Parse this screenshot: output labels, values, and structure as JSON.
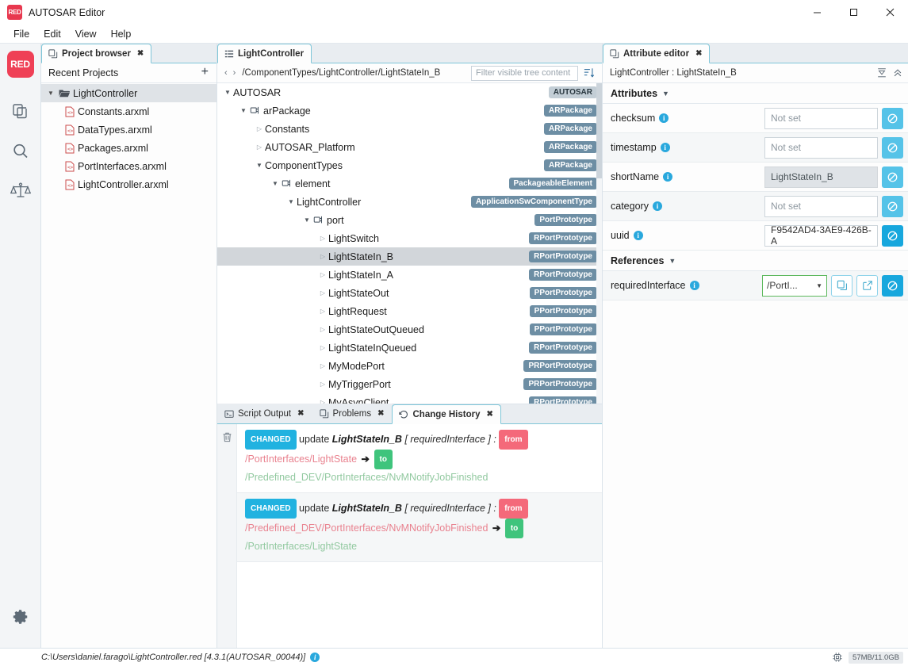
{
  "window": {
    "title": "AUTOSAR Editor",
    "logo_text": "RED",
    "controls": {
      "minimize": "minimize-button",
      "maximize": "maximize-button",
      "close": "close-button"
    }
  },
  "menubar": {
    "items": [
      "File",
      "Edit",
      "View",
      "Help"
    ]
  },
  "activitybar": {
    "logo_text": "RED",
    "items": [
      {
        "name": "project-browser-icon",
        "icon": "copy-pages-icon"
      },
      {
        "name": "search-icon",
        "icon": "magnifier-icon"
      },
      {
        "name": "compare-icon",
        "icon": "scales-icon"
      }
    ],
    "bottom": {
      "name": "settings-icon",
      "icon": "gear-icon"
    }
  },
  "project_browser": {
    "tab_label": "Project browser",
    "tab_close": "✖",
    "subheader": "Recent Projects",
    "add_label": "+",
    "root": {
      "label": "LightController",
      "expanded": true
    },
    "files": [
      "Constants.arxml",
      "DataTypes.arxml",
      "Packages.arxml",
      "PortInterfaces.arxml",
      "LightController.arxml"
    ]
  },
  "editor": {
    "tab_label": "LightController",
    "path": "/ComponentTypes/LightController/LightStateIn_B",
    "filter_placeholder": "Filter visible tree content",
    "nav_back": "‹",
    "nav_forward": "›",
    "tree": [
      {
        "label": "AUTOSAR",
        "badge": "AUTOSAR",
        "badge_style": "light",
        "indent": 0,
        "twist": "down",
        "icon": "none",
        "selected": false
      },
      {
        "label": "arPackage",
        "badge": "ARPackage",
        "badge_style": "dark",
        "indent": 1,
        "twist": "down",
        "icon": "package",
        "selected": false
      },
      {
        "label": "Constants",
        "badge": "ARPackage",
        "badge_style": "dark",
        "indent": 2,
        "twist": "right",
        "icon": "none",
        "selected": false
      },
      {
        "label": "AUTOSAR_Platform",
        "badge": "ARPackage",
        "badge_style": "dark",
        "indent": 2,
        "twist": "right",
        "icon": "none",
        "selected": false
      },
      {
        "label": "ComponentTypes",
        "badge": "ARPackage",
        "badge_style": "dark",
        "indent": 2,
        "twist": "down",
        "icon": "none",
        "selected": false
      },
      {
        "label": "element",
        "badge": "PackageableElement",
        "badge_style": "dark",
        "indent": 3,
        "twist": "down",
        "icon": "package",
        "selected": false
      },
      {
        "label": "LightController",
        "badge": "ApplicationSwComponentType",
        "badge_style": "dark",
        "indent": 4,
        "twist": "down",
        "icon": "none",
        "selected": false
      },
      {
        "label": "port",
        "badge": "PortPrototype",
        "badge_style": "dark",
        "indent": 5,
        "twist": "down",
        "icon": "package",
        "selected": false
      },
      {
        "label": "LightSwitch",
        "badge": "RPortPrototype",
        "badge_style": "dark",
        "indent": 6,
        "twist": "right",
        "icon": "none",
        "selected": false
      },
      {
        "label": "LightStateIn_B",
        "badge": "RPortPrototype",
        "badge_style": "dark",
        "indent": 6,
        "twist": "right",
        "icon": "none",
        "selected": true
      },
      {
        "label": "LightStateIn_A",
        "badge": "RPortPrototype",
        "badge_style": "dark",
        "indent": 6,
        "twist": "right",
        "icon": "none",
        "selected": false
      },
      {
        "label": "LightStateOut",
        "badge": "PPortPrototype",
        "badge_style": "dark",
        "indent": 6,
        "twist": "right",
        "icon": "none",
        "selected": false
      },
      {
        "label": "LightRequest",
        "badge": "PPortPrototype",
        "badge_style": "dark",
        "indent": 6,
        "twist": "right",
        "icon": "none",
        "selected": false
      },
      {
        "label": "LightStateOutQueued",
        "badge": "PPortPrototype",
        "badge_style": "dark",
        "indent": 6,
        "twist": "right",
        "icon": "none",
        "selected": false
      },
      {
        "label": "LightStateInQueued",
        "badge": "RPortPrototype",
        "badge_style": "dark",
        "indent": 6,
        "twist": "right",
        "icon": "none",
        "selected": false
      },
      {
        "label": "MyModePort",
        "badge": "PRPortPrototype",
        "badge_style": "dark",
        "indent": 6,
        "twist": "right",
        "icon": "none",
        "selected": false
      },
      {
        "label": "MyTriggerPort",
        "badge": "PRPortPrototype",
        "badge_style": "dark",
        "indent": 6,
        "twist": "right",
        "icon": "none",
        "selected": false
      },
      {
        "label": "MyAsynClient",
        "badge": "RPortPrototype",
        "badge_style": "dark",
        "indent": 6,
        "twist": "right",
        "icon": "none",
        "selected": false
      }
    ]
  },
  "bottom_panel": {
    "tabs": [
      {
        "label": "Script Output",
        "icon": "terminal-icon",
        "active": false
      },
      {
        "label": "Problems",
        "icon": "pages-icon",
        "active": false
      },
      {
        "label": "Change History",
        "icon": "history-icon",
        "active": true
      }
    ],
    "tab_close": "✖",
    "entries": [
      {
        "chip": "CHANGED",
        "verb": "update",
        "target": "LightStateIn_B",
        "attribute": "[ requiredInterface ] :",
        "from_chip": "from",
        "from_path": "/PortInterfaces/LightState",
        "to_chip": "to",
        "to_path": "/Predefined_DEV/PortInterfaces/NvMNotifyJobFinished"
      },
      {
        "chip": "CHANGED",
        "verb": "update",
        "target": "LightStateIn_B",
        "attribute": "[ requiredInterface ] :",
        "from_chip": "from",
        "from_path": "/Predefined_DEV/PortInterfaces/NvMNotifyJobFinished",
        "to_chip": "to",
        "to_path": "/PortInterfaces/LightState"
      }
    ]
  },
  "attribute_editor": {
    "tab_label": "Attribute editor",
    "tab_close": "✖",
    "subheader": "LightController : LightStateIn_B",
    "sections": {
      "attributes_label": "Attributes",
      "references_label": "References"
    },
    "attributes": [
      {
        "label": "checksum",
        "value": "",
        "placeholder": "Not set",
        "readonly": false,
        "shade": false,
        "btn": "clear-button"
      },
      {
        "label": "timestamp",
        "value": "",
        "placeholder": "Not set",
        "readonly": false,
        "shade": true,
        "btn": "clear-button"
      },
      {
        "label": "shortName",
        "value": "LightStateIn_B",
        "placeholder": "",
        "readonly": true,
        "shade": false,
        "btn": "clear-button"
      },
      {
        "label": "category",
        "value": "",
        "placeholder": "Not set",
        "readonly": false,
        "shade": true,
        "btn": "clear-button"
      },
      {
        "label": "uuid",
        "value": "F9542AD4-3AE9-426B-A",
        "placeholder": "",
        "readonly": false,
        "shade": false,
        "btn": "clear-button"
      }
    ],
    "references": [
      {
        "label": "requiredInterface",
        "value": "/PortI...",
        "shade": true
      }
    ]
  },
  "statusbar": {
    "path": "C:\\Users\\daniel.farago\\LightController.red [4.3.1(AUTOSAR_00044)]",
    "memory": "57MB/11.0GB"
  },
  "colors": {
    "accent_red": "#ef4056",
    "badge_dark": "#6d8ea4",
    "badge_light": "#c3ced6",
    "chip_changed": "#21b2e0",
    "chip_from": "#f4697a",
    "chip_to": "#3fc47c",
    "tab_border": "#7fc6d8",
    "btn_blue": "#55c3e8"
  }
}
